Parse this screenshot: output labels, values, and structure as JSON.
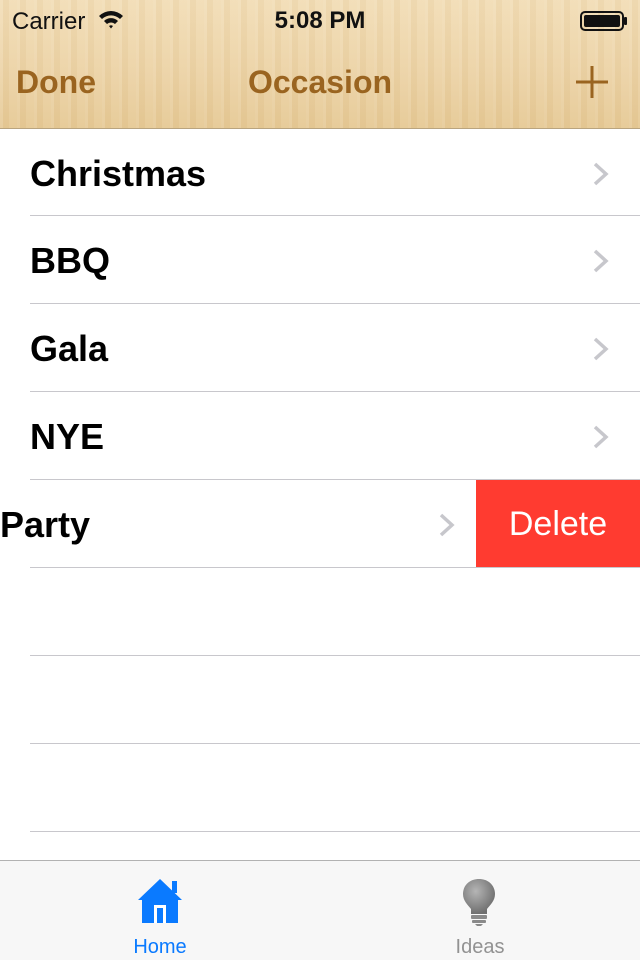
{
  "status_bar": {
    "carrier": "Carrier",
    "time": "5:08 PM",
    "wifi_icon": "wifi-icon",
    "battery_icon": "battery-icon"
  },
  "navbar": {
    "left_button": "Done",
    "title": "Occasion",
    "right_icon": "plus-icon",
    "tint_color": "#9a6420"
  },
  "list": {
    "items": [
      {
        "label": "Christmas"
      },
      {
        "label": "BBQ"
      },
      {
        "label": "Gala"
      },
      {
        "label": "NYE"
      },
      {
        "label": "Party",
        "swiped": true,
        "delete_label": "Delete"
      }
    ],
    "chevron_icon": "chevron-right-icon",
    "delete_color": "#ff3b30"
  },
  "tabbar": {
    "tabs": [
      {
        "label": "Home",
        "icon": "home-icon",
        "selected": true
      },
      {
        "label": "Ideas",
        "icon": "lightbulb-icon",
        "selected": false
      }
    ],
    "selected_color": "#0a7aff",
    "unselected_color": "#929292"
  }
}
